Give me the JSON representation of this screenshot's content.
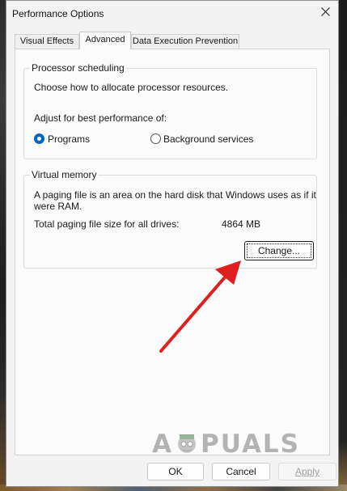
{
  "window": {
    "title": "Performance Options"
  },
  "tabs": [
    {
      "label": "Visual Effects",
      "active": false
    },
    {
      "label": "Advanced",
      "active": true
    },
    {
      "label": "Data Execution Prevention",
      "active": false
    }
  ],
  "processor": {
    "group_label": "Processor scheduling",
    "description": "Choose how to allocate processor resources.",
    "adjust_label": "Adjust for best performance of:",
    "options": [
      {
        "label": "Programs",
        "selected": true
      },
      {
        "label": "Background services",
        "selected": false
      }
    ]
  },
  "virtual_memory": {
    "group_label": "Virtual memory",
    "description_line1": "A paging file is an area on the hard disk that Windows uses as if it",
    "description_line2": "were RAM.",
    "total_label": "Total paging file size for all drives:",
    "total_value": "4864 MB",
    "change_button": "Change..."
  },
  "footer": {
    "ok": "OK",
    "cancel": "Cancel",
    "apply": "Apply"
  },
  "watermark": {
    "text_before": "A",
    "text_after": "PUALS"
  },
  "colors": {
    "accent": "#0067c0",
    "arrow": "#e02020"
  },
  "icons": {
    "close": "close-icon",
    "arrow": "red-arrow-annotation"
  }
}
